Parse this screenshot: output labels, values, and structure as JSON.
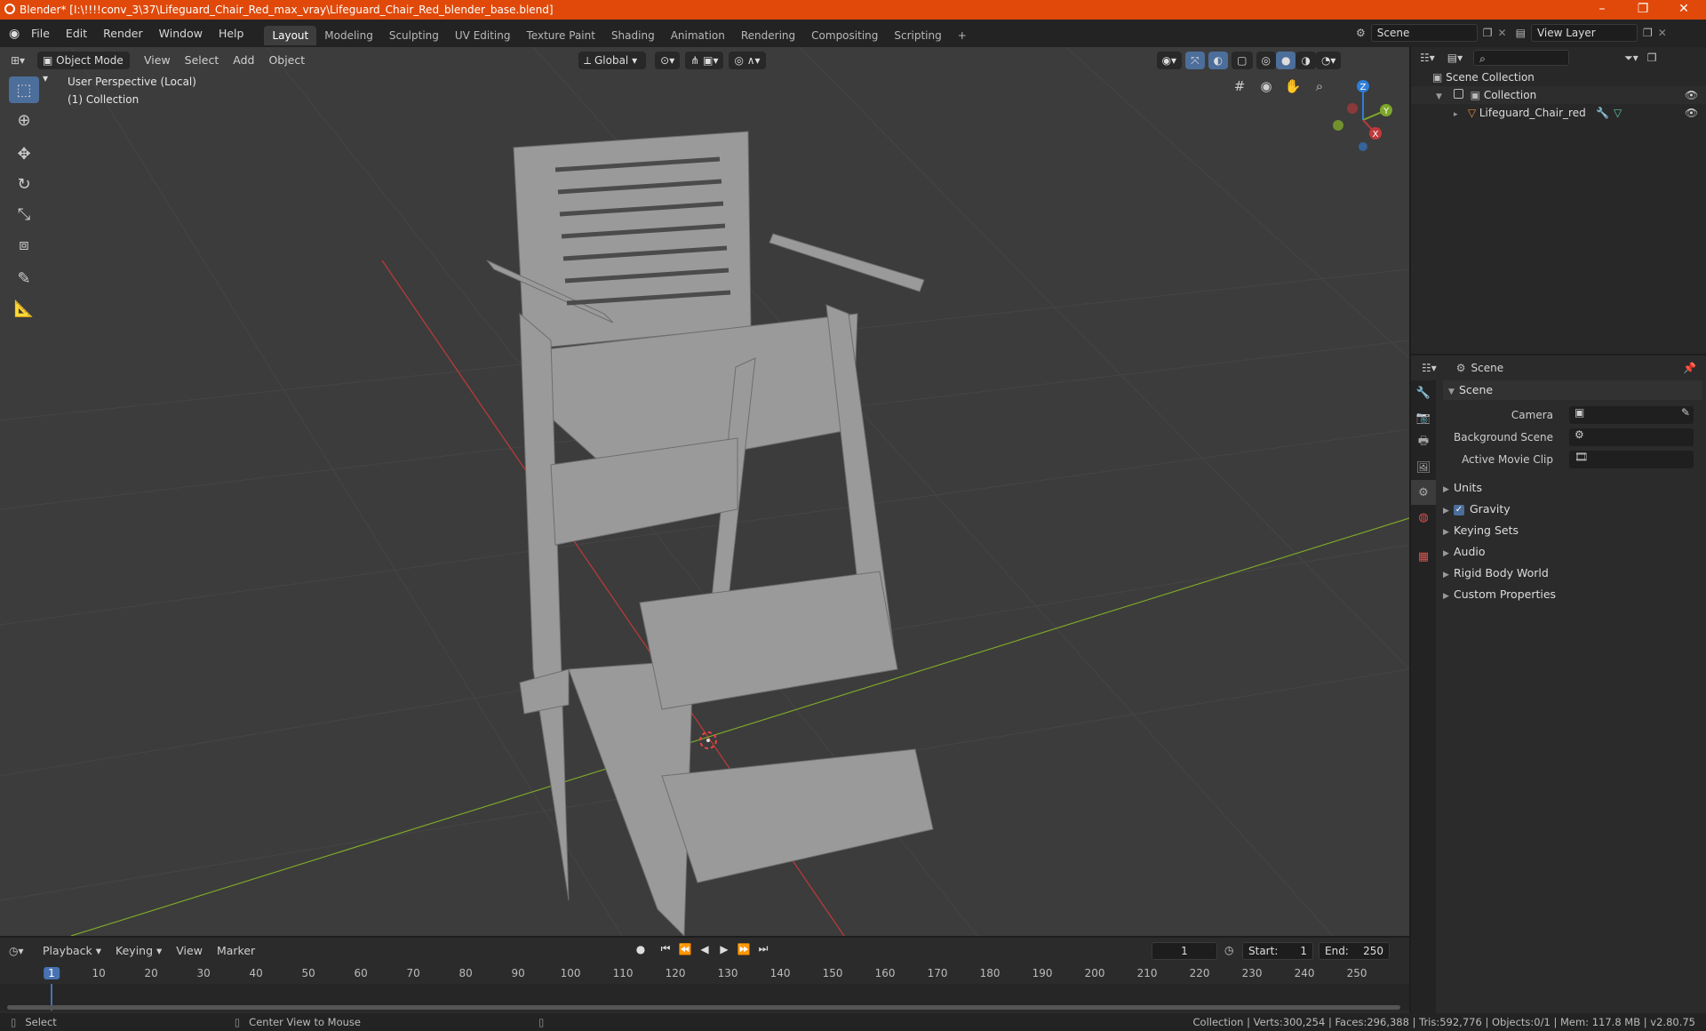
{
  "titlebar": {
    "title": "Blender* [I:\\!!!!conv_3\\37\\Lifeguard_Chair_Red_max_vray\\Lifeguard_Chair_Red_blender_base.blend]",
    "minimize": "–",
    "maximize": "❐",
    "close": "✕"
  },
  "menubar": {
    "menus": [
      "File",
      "Edit",
      "Render",
      "Window",
      "Help"
    ],
    "workspaces": [
      "Layout",
      "Modeling",
      "Sculpting",
      "UV Editing",
      "Texture Paint",
      "Shading",
      "Animation",
      "Rendering",
      "Compositing",
      "Scripting"
    ],
    "active_workspace": "Layout",
    "add_workspace": "+",
    "scene": "Scene",
    "view_layer": "View Layer"
  },
  "viewport": {
    "mode": "Object Mode",
    "menus": [
      "View",
      "Select",
      "Add",
      "Object"
    ],
    "orientation": "Global",
    "perspective_label": "User Perspective (Local)",
    "collection_label": "(1) Collection",
    "gizmo_axes": {
      "x": "X",
      "y": "Y",
      "z": "Z"
    }
  },
  "outliner": {
    "root": "Scene Collection",
    "collection": "Collection",
    "object": "Lifeguard_Chair_red"
  },
  "properties": {
    "context": "Scene",
    "panel": "Scene",
    "camera_label": "Camera",
    "background_scene_label": "Background Scene",
    "movie_clip_label": "Active Movie Clip",
    "sections": [
      "Units",
      "Gravity",
      "Keying Sets",
      "Audio",
      "Rigid Body World",
      "Custom Properties"
    ]
  },
  "timeline": {
    "menus": [
      "Playback",
      "Keying",
      "View",
      "Marker"
    ],
    "current_frame": "1",
    "start_label": "Start:",
    "start": "1",
    "end_label": "End:",
    "end": "250",
    "ticks": [
      "1",
      "10",
      "20",
      "30",
      "40",
      "50",
      "60",
      "70",
      "80",
      "90",
      "100",
      "110",
      "120",
      "130",
      "140",
      "150",
      "160",
      "170",
      "180",
      "190",
      "200",
      "210",
      "220",
      "230",
      "240",
      "250"
    ]
  },
  "statusbar": {
    "select": "Select",
    "center_view": "Center View to Mouse",
    "stats": "Collection | Verts:300,254 | Faces:296,388 | Tris:592,776 | Objects:0/1 | Mem: 117.8 MB | v2.80.75"
  },
  "colors": {
    "titlebar": "#e0490a",
    "viewport_bg": "#3c3c3c",
    "active_tool": "#4c6e9b",
    "x_axis": "#c0393b",
    "y_axis": "#7ea62a",
    "z_axis": "#2f7ed8",
    "playhead": "#4772b3"
  }
}
